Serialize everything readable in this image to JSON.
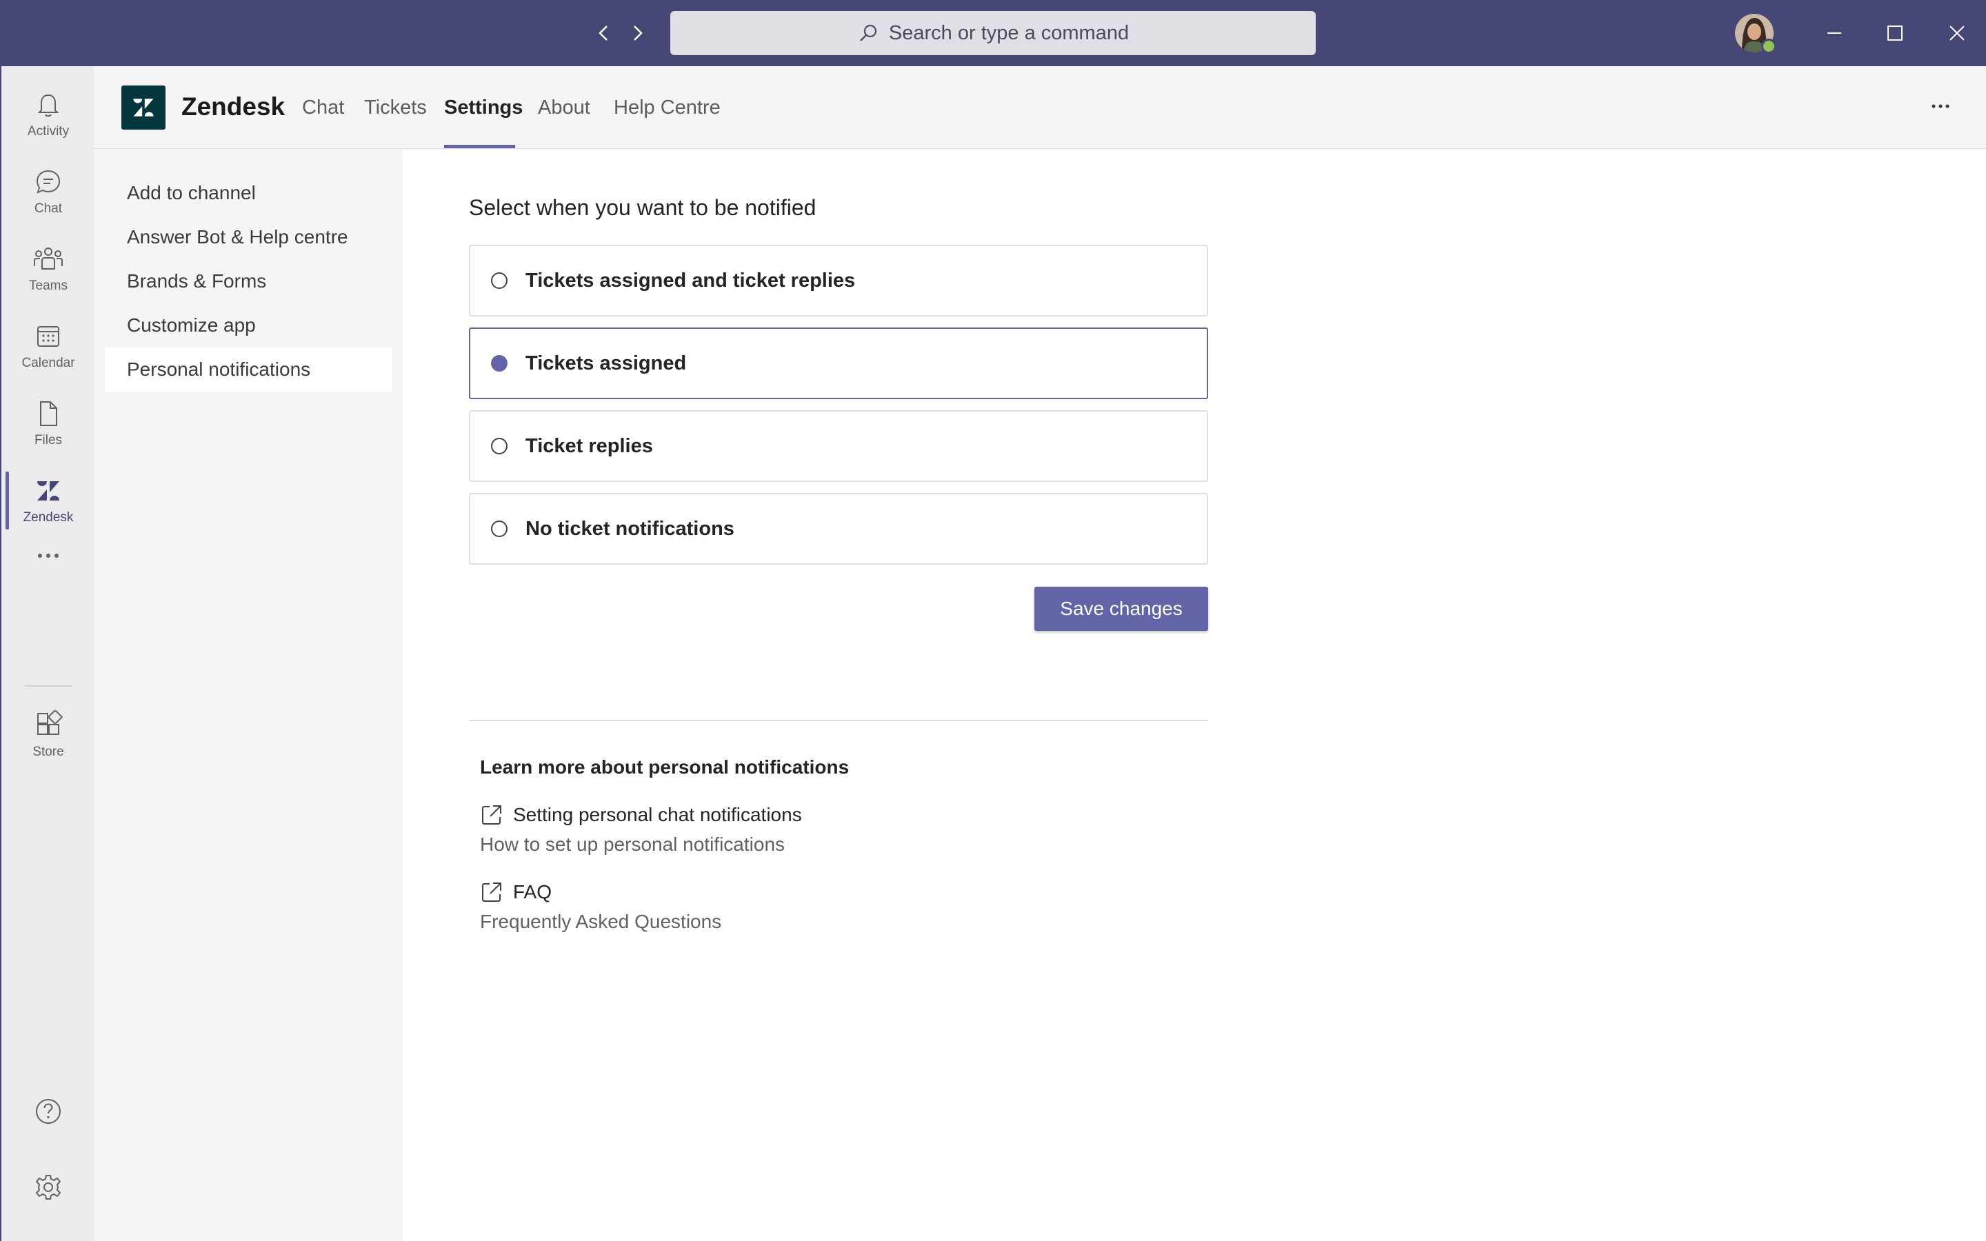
{
  "titlebar": {
    "search_placeholder": "Search or type a command"
  },
  "rail": {
    "items": [
      {
        "label": "Activity",
        "icon": "bell-icon"
      },
      {
        "label": "Chat",
        "icon": "chat-icon"
      },
      {
        "label": "Teams",
        "icon": "teams-icon"
      },
      {
        "label": "Calendar",
        "icon": "calendar-icon"
      },
      {
        "label": "Files",
        "icon": "file-icon"
      },
      {
        "label": "Zendesk",
        "icon": "zendesk-icon",
        "active": true
      },
      {
        "label": "Store",
        "icon": "store-icon"
      }
    ]
  },
  "app": {
    "name": "Zendesk",
    "tabs": [
      "Chat",
      "Tickets",
      "Settings",
      "About",
      "Help Centre"
    ],
    "active_tab": "Settings"
  },
  "sidenav": {
    "items": [
      "Add to channel",
      "Answer Bot & Help centre",
      "Brands & Forms",
      "Customize app",
      "Personal notifications"
    ],
    "active": "Personal notifications"
  },
  "main": {
    "heading": "Select when you want to be notified",
    "options": [
      {
        "label": "Tickets assigned and ticket replies",
        "selected": false
      },
      {
        "label": "Tickets assigned",
        "selected": true
      },
      {
        "label": "Ticket replies",
        "selected": false
      },
      {
        "label": "No ticket notifications",
        "selected": false
      }
    ],
    "save_label": "Save changes",
    "learn_more": {
      "title": "Learn more about personal notifications",
      "links": [
        {
          "title": "Setting personal chat notifications",
          "subtitle": "How to set up personal notifications"
        },
        {
          "title": "FAQ",
          "subtitle": "Frequently Asked Questions"
        }
      ]
    }
  },
  "colors": {
    "titlebar": "#464775",
    "accent": "#6264a7",
    "presence": "#92c353",
    "zendesk_logo": "#03363d"
  }
}
